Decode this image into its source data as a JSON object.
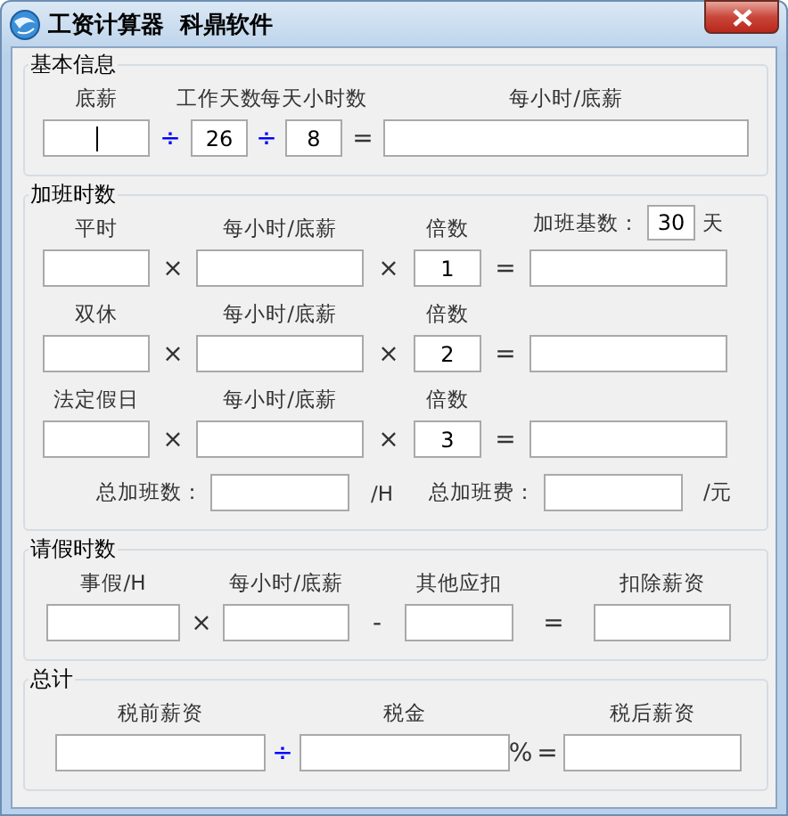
{
  "window": {
    "title": "工资计算器  科鼎软件"
  },
  "sections": [
    {
      "title": "基本信息",
      "rows": [
        {
          "kind": "grid",
          "cells": [
            {
              "kind": "field",
              "label": "底薪",
              "focused": true
            },
            {
              "kind": "sign",
              "text": "÷",
              "color": "#0000ff"
            },
            {
              "kind": "field",
              "label": "工作天数",
              "value": "26"
            },
            {
              "kind": "sign",
              "text": "÷",
              "color": "#0000ff"
            },
            {
              "kind": "field",
              "label": "每天小时数",
              "value": "8"
            },
            {
              "kind": "sign",
              "text": "=",
              "color": "#333333"
            },
            {
              "kind": "field",
              "label": "每小时/底薪"
            }
          ]
        }
      ]
    },
    {
      "title": "加班时数",
      "rows": [
        {
          "kind": "grid",
          "cells": [
            {
              "kind": "field",
              "label": "平时"
            },
            {
              "kind": "sign",
              "text": "×",
              "color": "#333333"
            },
            {
              "kind": "field",
              "label": "每小时/底薪"
            },
            {
              "kind": "sign",
              "text": "×",
              "color": "#333333"
            },
            {
              "kind": "field",
              "label": "倍数",
              "value": "1"
            },
            {
              "kind": "sign",
              "text": "=",
              "color": "#333333"
            },
            {
              "kind": "field",
              "base": {
                "label": "加班基数：",
                "value": "30",
                "unit": "天"
              }
            }
          ]
        },
        {
          "kind": "grid",
          "cells": [
            {
              "kind": "field",
              "label": "双休"
            },
            {
              "kind": "sign",
              "text": "×",
              "color": "#333333"
            },
            {
              "kind": "field",
              "label": "每小时/底薪"
            },
            {
              "kind": "sign",
              "text": "×",
              "color": "#333333"
            },
            {
              "kind": "field",
              "label": "倍数",
              "value": "2"
            },
            {
              "kind": "sign",
              "text": "=",
              "color": "#333333"
            },
            {
              "kind": "field"
            }
          ]
        },
        {
          "kind": "grid",
          "cells": [
            {
              "kind": "field",
              "label": "法定假日"
            },
            {
              "kind": "sign",
              "text": "×",
              "color": "#333333"
            },
            {
              "kind": "field",
              "label": "每小时/底薪"
            },
            {
              "kind": "sign",
              "text": "×",
              "color": "#333333"
            },
            {
              "kind": "field",
              "label": "倍数",
              "value": "3"
            },
            {
              "kind": "sign",
              "text": "=",
              "color": "#333333"
            },
            {
              "kind": "field"
            }
          ]
        },
        {
          "kind": "totals",
          "items": [
            {
              "label": "总加班数：",
              "unit": "/H"
            },
            {
              "label": "总加班费：",
              "unit": "/元"
            }
          ]
        }
      ]
    },
    {
      "title": "请假时数",
      "rows": [
        {
          "kind": "grid",
          "cells": [
            {
              "kind": "field",
              "label": "事假/H"
            },
            {
              "kind": "sign",
              "text": "×",
              "color": "#333333"
            },
            {
              "kind": "field",
              "label": "每小时/底薪"
            },
            {
              "kind": "sign",
              "text": "-",
              "color": "#333333"
            },
            {
              "kind": "field",
              "label": "其他应扣"
            },
            {
              "kind": "sign",
              "text": "=",
              "color": "#333333"
            },
            {
              "kind": "field",
              "label": "扣除薪资"
            }
          ]
        }
      ]
    },
    {
      "title": "总计",
      "rows": [
        {
          "kind": "grid",
          "cells": [
            {
              "kind": "field",
              "label": "税前薪资"
            },
            {
              "kind": "sign",
              "text": "÷",
              "color": "#0000ff"
            },
            {
              "kind": "field",
              "label": "税金"
            },
            {
              "kind": "sign",
              "text": "%",
              "color": "#333333"
            },
            {
              "kind": "sign",
              "text": "=",
              "color": "#333333"
            },
            {
              "kind": "field",
              "label": "税后薪资"
            }
          ]
        }
      ]
    }
  ]
}
